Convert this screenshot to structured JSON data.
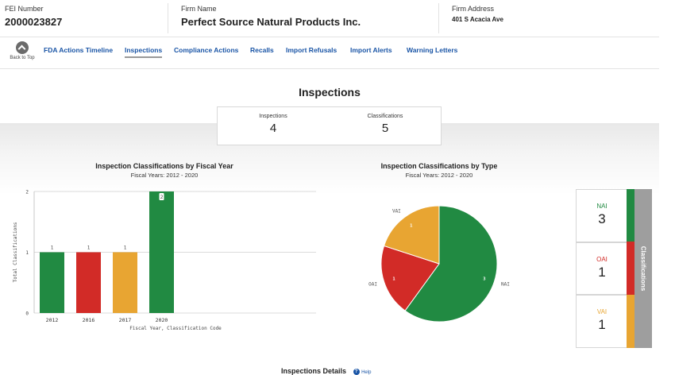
{
  "header": {
    "fei_label": "FEI Number",
    "fei_value": "2000023827",
    "firm_label": "Firm Name",
    "firm_value": "Perfect Source Natural Products Inc.",
    "address_label": "Firm Address",
    "address_value": "401 S Acacia Ave"
  },
  "nav": {
    "back_to_top": "Back to Top",
    "tabs": [
      "FDA Actions Timeline",
      "Inspections",
      "Compliance Actions",
      "Recalls",
      "Import Refusals",
      "Import Alerts",
      "Warning Letters"
    ],
    "active": "Inspections"
  },
  "section_title": "Inspections",
  "summary": {
    "inspections_label": "Inspections",
    "inspections_value": "4",
    "classifications_label": "Classifications",
    "classifications_value": "5"
  },
  "colors": {
    "NAI": "#218a42",
    "OAI": "#d22b27",
    "VAI": "#e8a532"
  },
  "chart_data": [
    {
      "type": "bar",
      "title": "Inspection Classifications by Fiscal Year",
      "subtitle": "Fiscal Years: 2012 - 2020",
      "xlabel": "Fiscal Year, Classification Code",
      "ylabel": "Total Classifications",
      "ylim": [
        0,
        2
      ],
      "yticks": [
        "0",
        "1",
        "2"
      ],
      "categories": [
        "2012",
        "2016",
        "2017",
        "2020"
      ],
      "values": [
        1,
        1,
        1,
        2
      ],
      "codes": [
        "NAI",
        "OAI",
        "VAI",
        "NAI"
      ],
      "labels": [
        "1",
        "1",
        "1",
        "2"
      ]
    },
    {
      "type": "pie",
      "title": "Inspection Classifications by Type",
      "subtitle": "Fiscal Years: 2012 - 2020",
      "slices": [
        {
          "label": "NAI",
          "value": 3
        },
        {
          "label": "OAI",
          "value": 1
        },
        {
          "label": "VAI",
          "value": 1
        }
      ]
    }
  ],
  "panel": {
    "title": "Classifications",
    "items": [
      {
        "label": "NAI",
        "value": "3"
      },
      {
        "label": "OAI",
        "value": "1"
      },
      {
        "label": "VAI",
        "value": "1"
      }
    ]
  },
  "details": {
    "title": "Inspections Details",
    "help": "Help"
  }
}
